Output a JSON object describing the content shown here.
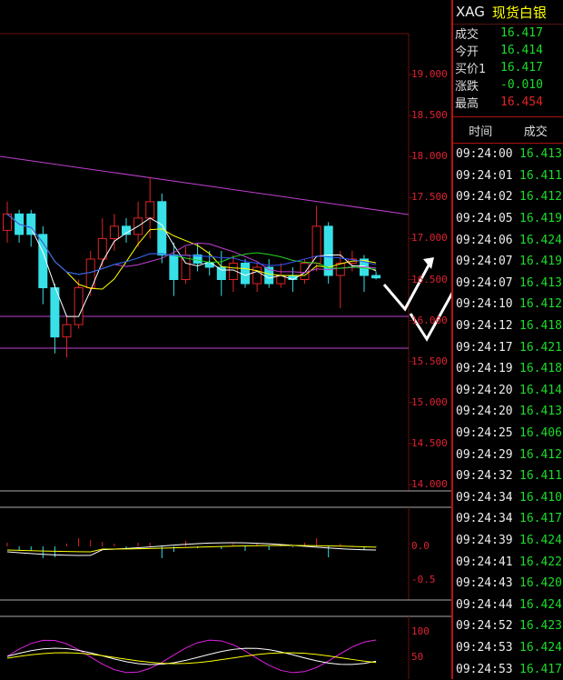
{
  "header": {
    "code": "XAG",
    "name": "现货白银"
  },
  "quote": [
    {
      "label": "成交",
      "value": "16.417",
      "color": "#1ddc2a"
    },
    {
      "label": "今开",
      "value": "16.414",
      "color": "#1ddc2a"
    },
    {
      "label": "买价1",
      "value": "16.417",
      "color": "#1ddc2a"
    },
    {
      "label": "涨跌",
      "value": "-0.010",
      "color": "#1ddc2a"
    },
    {
      "label": "最高",
      "value": "16.454",
      "color": "#e02424"
    }
  ],
  "ticks_header": {
    "time": "时间",
    "price": "成交"
  },
  "ticks": [
    {
      "time": "09:24:00",
      "price": "16.413"
    },
    {
      "time": "09:24:01",
      "price": "16.411"
    },
    {
      "time": "09:24:02",
      "price": "16.412"
    },
    {
      "time": "09:24:05",
      "price": "16.419"
    },
    {
      "time": "09:24:06",
      "price": "16.424"
    },
    {
      "time": "09:24:07",
      "price": "16.419"
    },
    {
      "time": "09:24:07",
      "price": "16.413"
    },
    {
      "time": "09:24:10",
      "price": "16.412"
    },
    {
      "time": "09:24:12",
      "price": "16.418"
    },
    {
      "time": "09:24:17",
      "price": "16.421"
    },
    {
      "time": "09:24:19",
      "price": "16.418"
    },
    {
      "time": "09:24:20",
      "price": "16.414"
    },
    {
      "time": "09:24:20",
      "price": "16.413"
    },
    {
      "time": "09:24:25",
      "price": "16.406"
    },
    {
      "time": "09:24:29",
      "price": "16.412"
    },
    {
      "time": "09:24:32",
      "price": "16.411"
    },
    {
      "time": "09:24:34",
      "price": "16.410"
    },
    {
      "time": "09:24:34",
      "price": "16.417"
    },
    {
      "time": "09:24:39",
      "price": "16.424"
    },
    {
      "time": "09:24:41",
      "price": "16.422"
    },
    {
      "time": "09:24:43",
      "price": "16.420"
    },
    {
      "time": "09:24:44",
      "price": "16.424"
    },
    {
      "time": "09:24:52",
      "price": "16.423"
    },
    {
      "time": "09:24:53",
      "price": "16.424"
    },
    {
      "time": "09:24:53",
      "price": "16.417"
    }
  ],
  "price_axis": [
    "19.000",
    "18.500",
    "18.000",
    "17.500",
    "17.000",
    "16.500",
    "16.000",
    "15.500",
    "15.000",
    "14.500",
    "14.000"
  ],
  "macd_axis": [
    "0.0",
    "-0.5"
  ],
  "kdj_axis": [
    "100",
    "50"
  ],
  "candles": [
    {
      "o": 17.1,
      "h": 17.45,
      "l": 16.95,
      "c": 17.3
    },
    {
      "o": 17.3,
      "h": 17.35,
      "l": 16.95,
      "c": 17.05
    },
    {
      "o": 17.3,
      "h": 17.35,
      "l": 16.9,
      "c": 17.05
    },
    {
      "o": 17.05,
      "h": 17.15,
      "l": 16.2,
      "c": 16.4
    },
    {
      "o": 16.4,
      "h": 16.45,
      "l": 15.6,
      "c": 15.8
    },
    {
      "o": 15.8,
      "h": 16.05,
      "l": 15.55,
      "c": 15.95
    },
    {
      "o": 15.95,
      "h": 16.5,
      "l": 15.9,
      "c": 16.4
    },
    {
      "o": 16.4,
      "h": 16.85,
      "l": 16.3,
      "c": 16.75
    },
    {
      "o": 16.75,
      "h": 17.25,
      "l": 16.65,
      "c": 17.0
    },
    {
      "o": 17.0,
      "h": 17.3,
      "l": 16.85,
      "c": 17.15
    },
    {
      "o": 17.15,
      "h": 17.25,
      "l": 16.95,
      "c": 17.05
    },
    {
      "o": 17.05,
      "h": 17.45,
      "l": 16.9,
      "c": 17.25
    },
    {
      "o": 17.25,
      "h": 17.75,
      "l": 17.0,
      "c": 17.45
    },
    {
      "o": 17.45,
      "h": 17.55,
      "l": 16.7,
      "c": 16.8
    },
    {
      "o": 16.8,
      "h": 16.95,
      "l": 16.3,
      "c": 16.5
    },
    {
      "o": 16.5,
      "h": 16.9,
      "l": 16.45,
      "c": 16.8
    },
    {
      "o": 16.8,
      "h": 16.95,
      "l": 16.6,
      "c": 16.7
    },
    {
      "o": 16.7,
      "h": 16.85,
      "l": 16.55,
      "c": 16.65
    },
    {
      "o": 16.65,
      "h": 16.85,
      "l": 16.3,
      "c": 16.5
    },
    {
      "o": 16.5,
      "h": 16.8,
      "l": 16.35,
      "c": 16.7
    },
    {
      "o": 16.7,
      "h": 16.75,
      "l": 16.4,
      "c": 16.45
    },
    {
      "o": 16.45,
      "h": 16.7,
      "l": 16.35,
      "c": 16.65
    },
    {
      "o": 16.65,
      "h": 16.75,
      "l": 16.4,
      "c": 16.45
    },
    {
      "o": 16.45,
      "h": 16.7,
      "l": 16.4,
      "c": 16.55
    },
    {
      "o": 16.55,
      "h": 16.65,
      "l": 16.35,
      "c": 16.5
    },
    {
      "o": 16.5,
      "h": 16.75,
      "l": 16.45,
      "c": 16.7
    },
    {
      "o": 16.7,
      "h": 17.4,
      "l": 16.6,
      "c": 17.15
    },
    {
      "o": 17.15,
      "h": 17.2,
      "l": 16.45,
      "c": 16.55
    },
    {
      "o": 16.55,
      "h": 16.85,
      "l": 16.15,
      "c": 16.7
    },
    {
      "o": 16.7,
      "h": 16.85,
      "l": 16.6,
      "c": 16.75
    },
    {
      "o": 16.75,
      "h": 16.8,
      "l": 16.35,
      "c": 16.55
    },
    {
      "o": 16.55,
      "h": 16.6,
      "l": 16.5,
      "c": 16.52
    }
  ],
  "colors": {
    "up": "#e02424",
    "down": "#38e0e8",
    "grid": "#6b0f0f",
    "trend": "#c040d0"
  }
}
